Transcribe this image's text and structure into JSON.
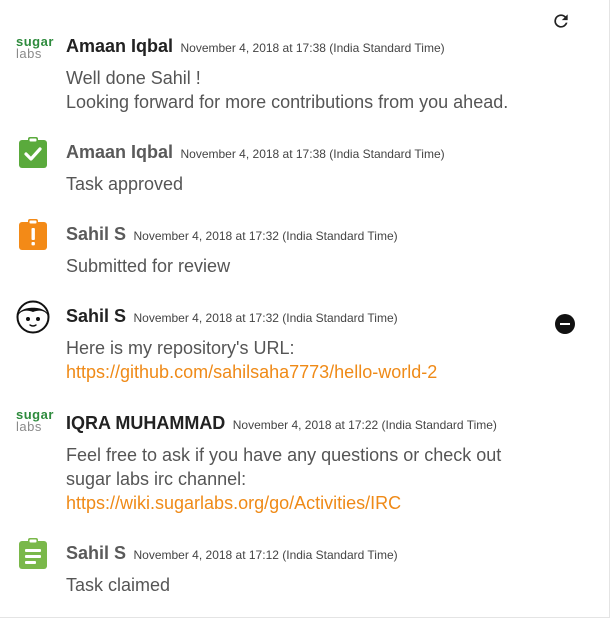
{
  "colors": {
    "accent_link": "#ef8a17",
    "approved_green": "#5aaa3c",
    "review_orange": "#f38a17",
    "claimed_green": "#7ab84a"
  },
  "toolbar": {
    "refresh_icon": "refresh-icon"
  },
  "logo": {
    "line1": "sugar",
    "line2": "labs"
  },
  "entries": [
    {
      "name": "Amaan Iqbal",
      "date": "November 4, 2018 at 17:38 (India Standard Time)",
      "lines": [
        "Well done Sahil !",
        "Looking forward for more contributions from you ahead."
      ],
      "icon": "sugarlabs-logo"
    },
    {
      "name": "Amaan Iqbal",
      "date": "November 4, 2018 at 17:38 (India Standard Time)",
      "lines": [
        "Task approved"
      ],
      "icon": "clipboard-check-icon"
    },
    {
      "name": "Sahil S",
      "date": "November 4, 2018 at 17:32 (India Standard Time)",
      "lines": [
        "Submitted for review"
      ],
      "icon": "clipboard-alert-icon"
    },
    {
      "name": "Sahil S",
      "date": "November 4, 2018 at 17:32 (India Standard Time)",
      "lines": [
        "Here is my repository's URL:"
      ],
      "link": "https://github.com/sahilsaha7773/hello-world-2",
      "icon": "user-face-avatar"
    },
    {
      "name": "IQRA MUHAMMAD",
      "date": "November 4, 2018 at 17:22 (India Standard Time)",
      "lines": [
        "Feel free to ask if you have any questions or check out",
        "sugar labs irc channel:"
      ],
      "link": "https://wiki.sugarlabs.org/go/Activities/IRC",
      "icon": "sugarlabs-logo"
    },
    {
      "name": "Sahil S",
      "date": "November 4, 2018 at 17:12 (India Standard Time)",
      "lines": [
        "Task claimed"
      ],
      "icon": "clipboard-list-icon"
    }
  ]
}
